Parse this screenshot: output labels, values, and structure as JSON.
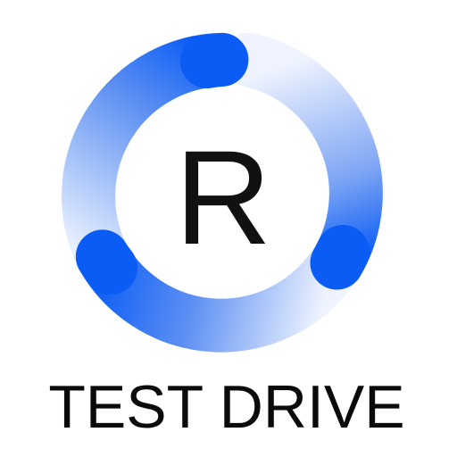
{
  "app": {
    "logo_letter": "R",
    "title": "TEST DRIVE"
  },
  "icon": {
    "name": "refresh-ring-icon",
    "accent_color": "#0A5CF5",
    "light_color": "#E8F0FE"
  }
}
